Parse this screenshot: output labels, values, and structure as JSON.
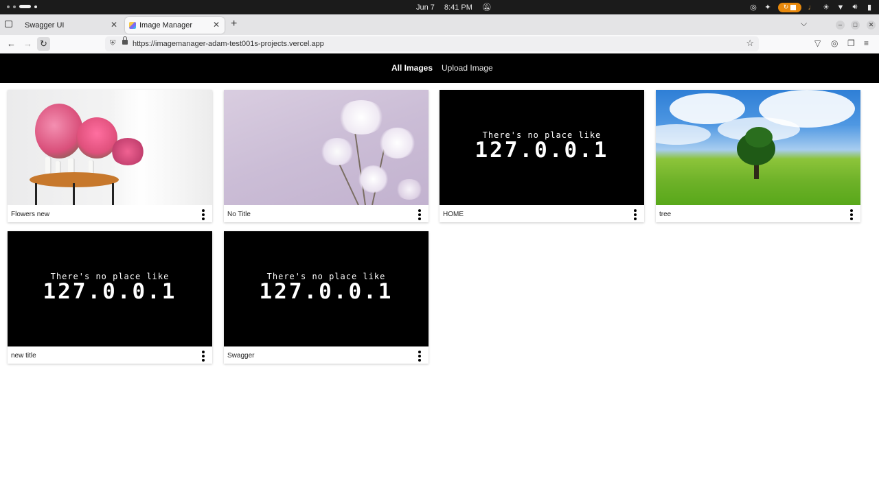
{
  "system_bar": {
    "date": "Jun 7",
    "time": "8:41 PM"
  },
  "browser": {
    "tabs": [
      {
        "title": "Swagger UI",
        "active": false
      },
      {
        "title": "Image Manager",
        "active": true
      }
    ],
    "url": "https://imagemanager-adam-test001s-projects.vercel.app"
  },
  "app": {
    "nav": {
      "all_images": "All Images",
      "upload_image": "Upload Image"
    },
    "images": [
      {
        "title": "Flowers new",
        "kind": "photo-flowers-table"
      },
      {
        "title": "No Title",
        "kind": "photo-white-flowers-lilac"
      },
      {
        "title": "HOME",
        "kind": "text-graphic",
        "line1": "There's no place like",
        "line2": "127.0.0.1"
      },
      {
        "title": "tree",
        "kind": "photo-tree-field"
      },
      {
        "title": "new title",
        "kind": "text-graphic",
        "line1": "There's no place like",
        "line2": "127.0.0.1"
      },
      {
        "title": "Swagger",
        "kind": "text-graphic",
        "line1": "There's no place like",
        "line2": "127.0.0.1"
      }
    ]
  },
  "colors": {
    "app_header_bg": "#000000",
    "page_bg": "#ffffff",
    "tab_strip_bg": "#e4e4e6"
  }
}
